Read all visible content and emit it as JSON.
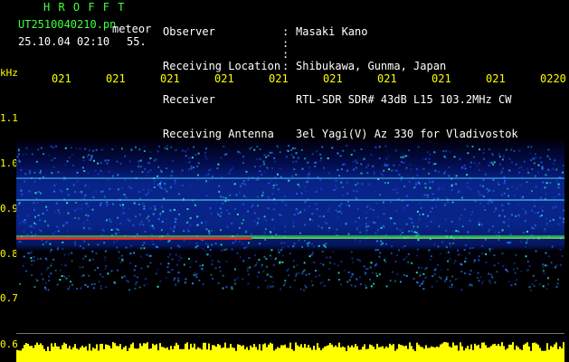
{
  "header": {
    "title": "H R O F F T",
    "filename": "UT2510040210.pn",
    "type": "meteor",
    "datetime": "25.10.04 02:10",
    "count": "55."
  },
  "info": [
    {
      "label": "Observer",
      "value": "Masaki Kano"
    },
    {
      "label": "Receiving Location",
      "value": "Shibukawa, Gunma, Japan"
    },
    {
      "label": "Receiver",
      "value": "RTL-SDR SDR# 43dB L15 103.2MHz CW"
    },
    {
      "label": "Receiving Antenna",
      "value": "3el Yagi(V) Az 330 for Vladivostok"
    }
  ],
  "axis": {
    "unit": "kHz",
    "y_ticks": [
      "1.1",
      "1.0",
      "0.9",
      "0.8",
      "0.7",
      "0.6"
    ],
    "x_ticks": [
      "021",
      "021",
      "021",
      "021",
      "021",
      "021",
      "021",
      "021",
      "021",
      "0220"
    ]
  },
  "colors": {
    "axis": "#ffff00",
    "title": "#40ff40",
    "background": "#000000"
  }
}
